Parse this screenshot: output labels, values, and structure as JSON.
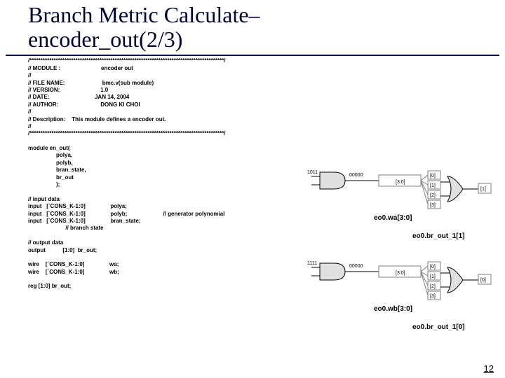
{
  "title_line1": "Branch Metric Calculate–",
  "title_line2": "encoder_out(2/3)",
  "code_text": "/*****************************************************************************************/\n// MODULE :                          encoder out\n//\n// FILE NAME:                        bmc.v(sub module)\n// VERSION:                          1.0\n// DATE:                             JAN 14, 2004\n// AUTHOR:                           DONG KI CHOI\n//\n// Description:    This module defines a encoder out.\n//\n/*****************************************************************************************/\n\nmodule en_out(\n                  polya,\n                  polyb,\n                  bran_state,\n                  br_out\n                  );\n\n// input data\ninput   [`CONS_K-1:0]                polya;\ninput   [`CONS_K-1:0]                polyb;                       // generator polynomial\ninput   [`CONS_K-1:0]                bran_state;\n                        // branch state\n\n// output data\noutput           [1:0]  br_out;\n\nwire    [`CONS_K-1:0]                wa;\nwire    [`CONS_K-1:0]                wb;\n\nreg [1:0] br_out;",
  "diag1": {
    "in_bits": "1011",
    "mid_bits": "00000",
    "bus_label": "[3:0]",
    "taps": [
      "[0]",
      "[1]",
      "[2]",
      "[3]"
    ],
    "out_bit": "[1]",
    "signal_a": "eo0.wa[3:0]",
    "signal_b": "eo0.br_out_1[1]"
  },
  "diag2": {
    "in_bits": "1111",
    "mid_bits": "00000",
    "bus_label": "[3:0]",
    "taps": [
      "[0]",
      "[1]",
      "[2]",
      "[3]"
    ],
    "out_bit": "[0]",
    "signal_a": "eo0.wb[3:0]",
    "signal_b": "eo0.br_out_1[0]"
  },
  "page_number": "12"
}
